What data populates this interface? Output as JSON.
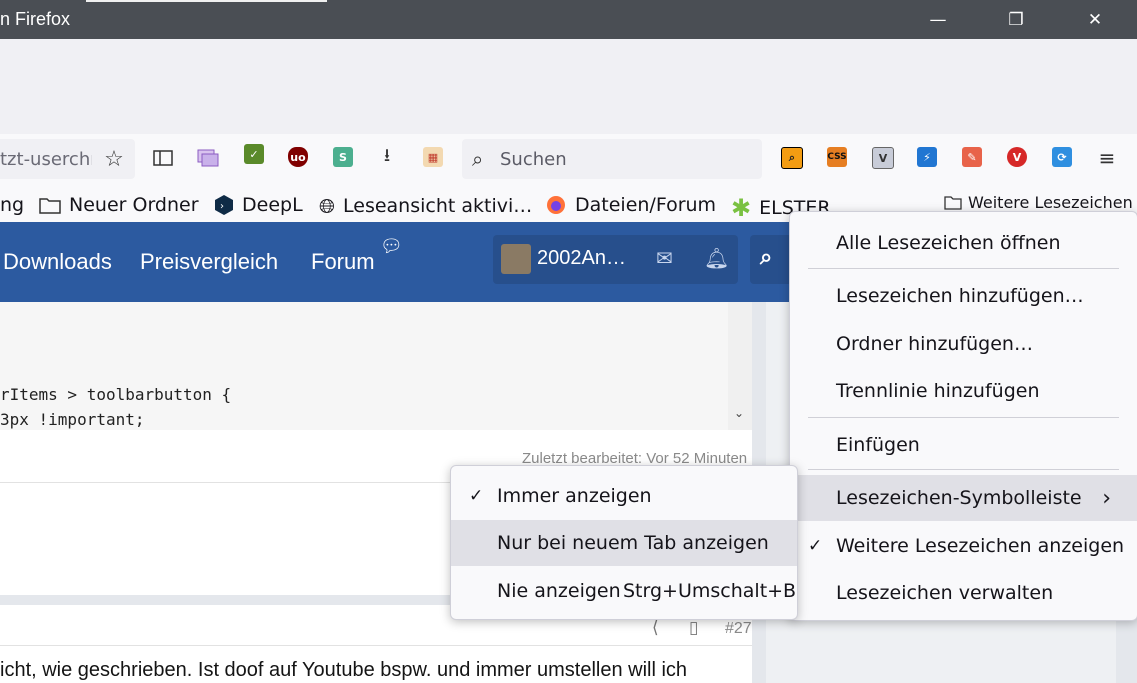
{
  "window": {
    "title": "n Firefox",
    "controls": {
      "minimize": "—",
      "restore": "❐",
      "close": "✕"
    }
  },
  "navbar": {
    "url_partial": "tzt-userchro",
    "search_placeholder": "Suchen",
    "icons": [
      "bookmark-star-icon",
      "sidebar-icon",
      "tab-manager-icon",
      "checkmark-extension-icon",
      "ublock-origin-icon",
      "s-extension-icon",
      "downloads-icon",
      "calendar-extension-icon"
    ],
    "extensions": [
      {
        "name": "zoom-extension-icon",
        "color": "#f39c12",
        "glyph": "⌕"
      },
      {
        "name": "css-extension-icon",
        "color": "#e67e22",
        "glyph": "CSS"
      },
      {
        "name": "v-extension-icon",
        "color": "#9aa0b4",
        "glyph": "V"
      },
      {
        "name": "bolt-extension-icon",
        "color": "#2176d2",
        "glyph": "⚡"
      },
      {
        "name": "screenshot-extension-icon",
        "color": "#e8634a",
        "glyph": "✎"
      },
      {
        "name": "vivaldi-extension-icon",
        "color": "#d62828",
        "glyph": "V"
      },
      {
        "name": "sync-extension-icon",
        "color": "#2f8fe0",
        "glyph": "⟳"
      }
    ],
    "menu_icon": "hamburger-menu-icon"
  },
  "bookmarks": {
    "items": [
      {
        "label": "ng",
        "icon": ""
      },
      {
        "label": "Neuer Ordner",
        "icon": "folder-icon"
      },
      {
        "label": "DeepL",
        "icon": "deepl-icon"
      },
      {
        "label": "Leseansicht aktivi…",
        "icon": "globe-icon"
      },
      {
        "label": "Dateien/Forum",
        "icon": "firefox-icon"
      },
      {
        "label": "ELSTER",
        "icon": "elster-star-icon"
      }
    ],
    "more": "Weitere Lesezeichen"
  },
  "site": {
    "nav": [
      "Downloads",
      "Preisvergleich",
      "Forum"
    ],
    "user": "2002An…",
    "code_lines": [
      "rItems > toolbarbutton {",
      "3px !important;"
    ],
    "edited": "Zuletzt bearbeitet: Vor 52 Minuten",
    "post_number": "#27",
    "post_text": "icht, wie geschrieben. Ist doof auf Youtube bspw. und immer umstellen will ich"
  },
  "bookmark_menu": {
    "items": [
      {
        "label": "Alle Lesezeichen öffnen",
        "checked": false
      },
      {
        "label": "Lesezeichen hinzufügen…",
        "checked": false
      },
      {
        "label": "Ordner hinzufügen…",
        "checked": false
      },
      {
        "label": "Trennlinie hinzufügen",
        "checked": false
      },
      {
        "label": "Einfügen",
        "checked": false
      },
      {
        "label": "Lesezeichen-Symbolleiste",
        "checked": false,
        "submenu": true
      },
      {
        "label": "Weitere Lesezeichen anzeigen",
        "checked": true
      },
      {
        "label": "Lesezeichen verwalten",
        "checked": false
      }
    ],
    "check_glyph": "✓",
    "arrow_glyph": "›"
  },
  "submenu": {
    "items": [
      {
        "label": "Immer anzeigen",
        "checked": true,
        "shortcut": ""
      },
      {
        "label": "Nur bei neuem Tab anzeigen",
        "checked": false,
        "shortcut": ""
      },
      {
        "label": "Nie anzeigen",
        "checked": false,
        "shortcut": "Strg+Umschalt+B"
      }
    ]
  }
}
